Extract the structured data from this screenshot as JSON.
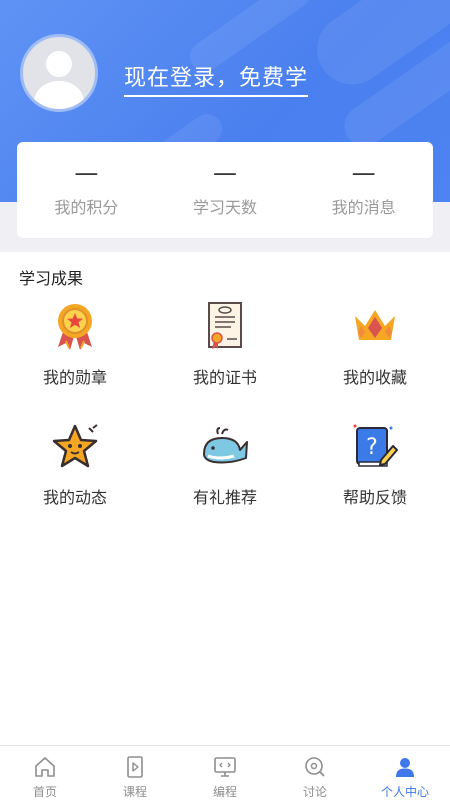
{
  "header": {
    "login_prompt": "现在登录，免费学"
  },
  "stats": [
    {
      "value": "—",
      "label": "我的积分"
    },
    {
      "value": "—",
      "label": "学习天数"
    },
    {
      "value": "—",
      "label": "我的消息"
    }
  ],
  "section": {
    "title": "学习成果"
  },
  "features": [
    {
      "label": "我的勋章",
      "icon": "medal-icon"
    },
    {
      "label": "我的证书",
      "icon": "certificate-icon"
    },
    {
      "label": "我的收藏",
      "icon": "crown-icon"
    },
    {
      "label": "我的动态",
      "icon": "star-icon"
    },
    {
      "label": "有礼推荐",
      "icon": "whale-icon"
    },
    {
      "label": "帮助反馈",
      "icon": "help-book-icon"
    }
  ],
  "tabbar": {
    "items": [
      {
        "label": "首页",
        "icon": "home-icon"
      },
      {
        "label": "课程",
        "icon": "course-icon"
      },
      {
        "label": "编程",
        "icon": "coding-icon"
      },
      {
        "label": "讨论",
        "icon": "discussion-icon"
      },
      {
        "label": "个人中心",
        "icon": "user-icon"
      }
    ],
    "active_index": 4
  },
  "colors": {
    "accent": "#3f78ea",
    "header": "#4a7fef",
    "muted": "#9a9a9a"
  }
}
